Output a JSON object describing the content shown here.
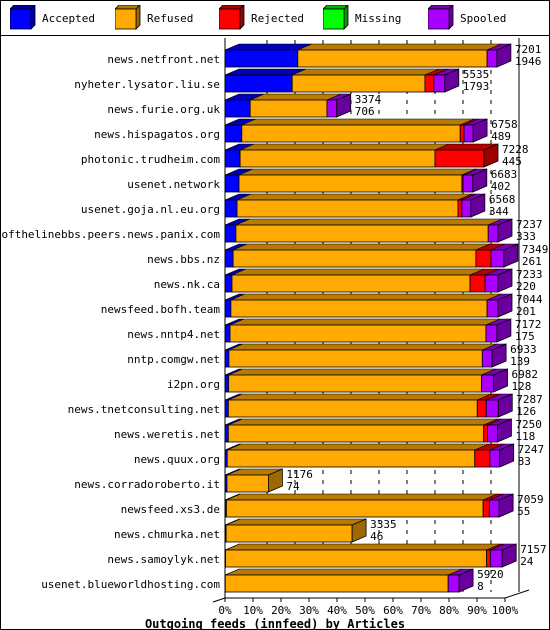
{
  "chart_data": {
    "type": "bar",
    "orientation": "horizontal",
    "stacked": true,
    "percent_stacked": true,
    "title": "Outgoing feeds (innfeed) by Articles",
    "xlabel": "",
    "ylabel": "",
    "xlim": [
      0,
      100
    ],
    "x_ticks": [
      "0%",
      "10%",
      "20%",
      "30%",
      "40%",
      "50%",
      "60%",
      "70%",
      "80%",
      "90%",
      "100%"
    ],
    "grid": true,
    "legend_position": "top",
    "legend": [
      {
        "name": "Accepted",
        "color": "#0000ff"
      },
      {
        "name": "Refused",
        "color": "#ffaa00"
      },
      {
        "name": "Rejected",
        "color": "#ff0000"
      },
      {
        "name": "Missing",
        "color": "#00ff00"
      },
      {
        "name": "Spooled",
        "color": "#aa00ff"
      }
    ],
    "categories": [
      "news.netfront.net",
      "nyheter.lysator.liu.se",
      "news.furie.org.uk",
      "news.hispagatos.org",
      "photonic.trudheim.com",
      "usenet.network",
      "usenet.goja.nl.eu.org",
      "endofthelinebbs.peers.news.panix.com",
      "news.bbs.nz",
      "news.nk.ca",
      "newsfeed.bofh.team",
      "news.nntp4.net",
      "nntp.comgw.net",
      "i2pn.org",
      "news.tnetconsulting.net",
      "news.weretis.net",
      "news.quux.org",
      "news.corradoroberto.it",
      "newsfeed.xs3.de",
      "news.chmurka.net",
      "news.samoylyk.net",
      "usenet.blueworldhosting.com"
    ],
    "totals": [
      7201,
      5535,
      3374,
      6758,
      7228,
      6683,
      6568,
      7237,
      7349,
      7233,
      7044,
      7172,
      6933,
      6982,
      7287,
      7250,
      7247,
      1176,
      7059,
      3335,
      7157,
      5920
    ],
    "accepted_counts": [
      1946,
      1793,
      706,
      489,
      445,
      402,
      344,
      333,
      261,
      220,
      201,
      175,
      139,
      128,
      126,
      118,
      83,
      74,
      55,
      46,
      24,
      8
    ],
    "series": [
      {
        "name": "Accepted",
        "values": [
          26.0,
          24.0,
          9.0,
          6.0,
          5.4,
          5.0,
          4.3,
          3.9,
          2.9,
          2.5,
          2.1,
          1.8,
          1.4,
          1.3,
          1.2,
          1.2,
          0.8,
          0.7,
          0.5,
          0.4,
          0.2,
          0.1
        ]
      },
      {
        "name": "Refused",
        "values": [
          67.6,
          47.4,
          27.4,
          78.0,
          69.6,
          79.6,
          78.9,
          90.1,
          86.7,
          85.0,
          91.5,
          91.4,
          90.5,
          90.3,
          88.9,
          91.2,
          88.4,
          14.8,
          91.7,
          45.0,
          93.2,
          79.6
        ]
      },
      {
        "name": "Rejected",
        "values": [
          0.0,
          3.2,
          0.0,
          1.4,
          17.5,
          0.4,
          1.4,
          0.0,
          5.4,
          5.4,
          0.0,
          0.0,
          0.0,
          0.0,
          3.2,
          1.4,
          5.4,
          0.0,
          2.2,
          0.0,
          1.4,
          0.0
        ]
      },
      {
        "name": "Missing",
        "values": [
          0,
          0,
          0,
          0,
          0,
          0,
          0,
          0,
          0,
          0,
          0,
          0,
          0,
          0,
          0,
          0,
          0,
          0,
          0,
          0,
          0,
          0
        ]
      },
      {
        "name": "Spooled",
        "values": [
          3.5,
          3.9,
          3.5,
          3.2,
          0.0,
          3.5,
          3.2,
          3.5,
          4.6,
          4.6,
          3.9,
          3.9,
          3.5,
          4.3,
          4.3,
          3.5,
          3.5,
          0.0,
          3.5,
          0.0,
          4.2,
          3.9
        ]
      }
    ]
  }
}
